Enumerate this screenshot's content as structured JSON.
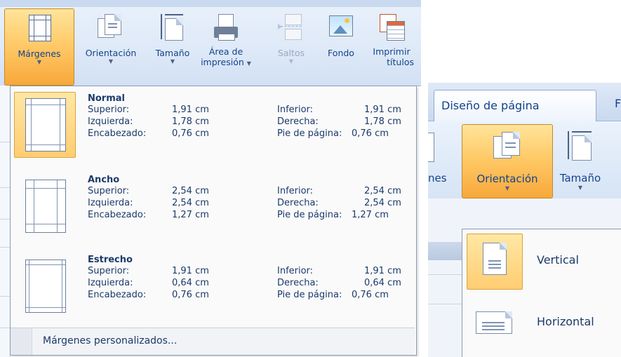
{
  "ribbon": {
    "buttons": [
      {
        "label": "Márgenes",
        "icon": "margins-icon",
        "state": "active"
      },
      {
        "label": "Orientación",
        "icon": "orientation-icon",
        "state": "normal"
      },
      {
        "label": "Tamaño",
        "icon": "size-icon",
        "state": "normal"
      },
      {
        "label1": "Área de",
        "label2": "impresión",
        "icon": "print-area-icon",
        "state": "normal"
      },
      {
        "label": "Saltos",
        "icon": "breaks-icon",
        "state": "disabled"
      },
      {
        "label": "Fondo",
        "icon": "background-icon",
        "state": "normal"
      },
      {
        "label1": "Imprimir",
        "label2": "títulos",
        "icon": "print-titles-icon",
        "state": "normal"
      }
    ]
  },
  "margins_menu": {
    "items": [
      {
        "name": "Normal",
        "selected": true,
        "left_labels": [
          "Superior:",
          "Izquierda:",
          "Encabezado:"
        ],
        "left_values": [
          "1,91 cm",
          "1,78 cm",
          "0,76 cm"
        ],
        "right_labels": [
          "Inferior:",
          "Derecha:",
          "Pie de página:"
        ],
        "right_values": [
          "1,91 cm",
          "1,78 cm",
          "0,76 cm"
        ]
      },
      {
        "name": "Ancho",
        "selected": false,
        "left_labels": [
          "Superior:",
          "Izquierda:",
          "Encabezado:"
        ],
        "left_values": [
          "2,54 cm",
          "2,54 cm",
          "1,27 cm"
        ],
        "right_labels": [
          "Inferior:",
          "Derecha:",
          "Pie de página:"
        ],
        "right_values": [
          "2,54 cm",
          "2,54 cm",
          "1,27 cm"
        ]
      },
      {
        "name": "Estrecho",
        "selected": false,
        "left_labels": [
          "Superior:",
          "Izquierda:",
          "Encabezado:"
        ],
        "left_values": [
          "1,91 cm",
          "0,64 cm",
          "0,76 cm"
        ],
        "right_labels": [
          "Inferior:",
          "Derecha:",
          "Pie de página:"
        ],
        "right_values": [
          "1,91 cm",
          "0,64 cm",
          "0,76 cm"
        ]
      }
    ],
    "custom_label": "Márgenes personalizados..."
  },
  "right_panel": {
    "tab_label": "Diseño de página",
    "tab_partial": "F",
    "partial_left_label": "nes",
    "buttons": [
      {
        "label": "Orientación",
        "icon": "orientation-icon",
        "state": "active"
      },
      {
        "label": "Tamaño",
        "icon": "size-icon",
        "state": "normal"
      }
    ],
    "orientation_menu": [
      {
        "label": "Vertical",
        "icon": "portrait-page-icon",
        "selected": true
      },
      {
        "label": "Horizontal",
        "icon": "landscape-page-icon",
        "selected": false
      }
    ]
  },
  "colors": {
    "accent_orange": "#ffcb6b",
    "ribbon_blue": "#dfeaf8",
    "text_blue": "#15428b"
  }
}
